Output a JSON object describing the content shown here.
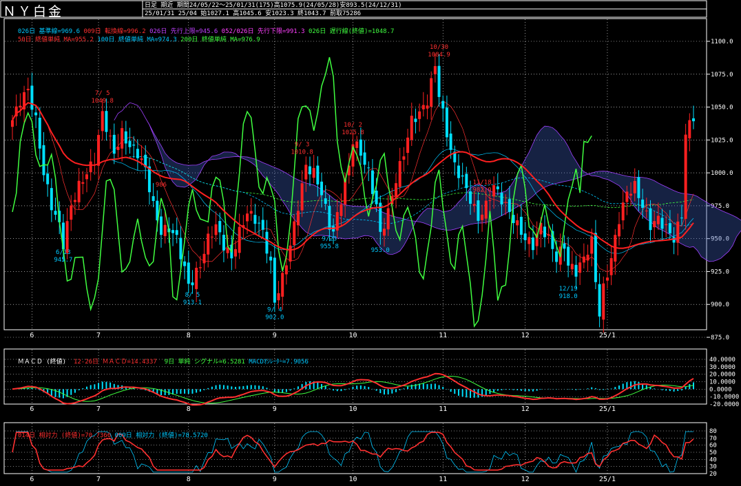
{
  "title": "ＮＹ白金",
  "info_row1": "日足 期近 期間24/05/22～25/01/31(175)高1075.9(24/05/28)安893.5(24/12/31)",
  "info_row2": "25/01/31 25/04 始1027.1 高1045.6 安1023.3 終1043.7 前取75286",
  "legend1": [
    {
      "text": "026日 基準線=969.6",
      "color": "#00c8ff"
    },
    {
      "text": "009日 転換線=996.2",
      "color": "#ff3030"
    },
    {
      "text": "026日 先行上限=945.6",
      "color": "#c040ff"
    },
    {
      "text": "052/026日 先行下限=991.3",
      "color": "#ff40ff"
    },
    {
      "text": "026日 遅行線(終値)=1048.7",
      "color": "#40ff40"
    }
  ],
  "legend2": [
    {
      "text": "50日 終値単純 MA=955.2",
      "color": "#ff3030"
    },
    {
      "text": "100日 終値単純 MA=974.3",
      "color": "#00c8ff"
    },
    {
      "text": "200日 終値単純 MA=976.9",
      "color": "#40ff40"
    }
  ],
  "macd_legend": [
    {
      "text": "ＭＡＣＤ (終値)",
      "color": "#ffffff"
    },
    {
      "text": "12-26日 ＭＡＣＤ=14.4337",
      "color": "#ff3030"
    },
    {
      "text": "9日 単純 シグナル=6.5281",
      "color": "#40ff40"
    },
    {
      "text": "MACDｵｼﾚｰﾀｰ=7.9056",
      "color": "#00c8ff"
    }
  ],
  "rsi_legend": [
    {
      "text": "014日 相対力 (終値)=70.7366",
      "color": "#ff3030"
    },
    {
      "text": "009日 相対力 (終値)=78.5720",
      "color": "#00c8ff"
    }
  ],
  "x_labels": [
    {
      "label": "6",
      "day": 5
    },
    {
      "label": "7",
      "day": 22
    },
    {
      "label": "8",
      "day": 45
    },
    {
      "label": "9",
      "day": 67
    },
    {
      "label": "10",
      "day": 87
    },
    {
      "label": "11",
      "day": 110
    },
    {
      "label": "12",
      "day": 131
    },
    {
      "label": "25/1",
      "day": 152
    }
  ],
  "chart_data": {
    "type": "candlestick",
    "price_axis": {
      "min": 875,
      "max": 1100,
      "ticks": [
        "1100.0",
        "1075.0",
        "1050.0",
        "1025.0",
        "1000.0",
        "975.0",
        "950.0",
        "925.0",
        "900.0",
        "875.0"
      ]
    },
    "macd_axis": {
      "min": -20,
      "max": 40,
      "ticks": [
        "40.0000",
        "30.0000",
        "20.0000",
        "10.0000",
        "0.0000",
        "-10.0000",
        "-20.0000"
      ]
    },
    "rsi_axis": {
      "min": 20,
      "max": 80,
      "ticks": [
        "80",
        "70",
        "60",
        "50",
        "40",
        "30",
        "20"
      ]
    },
    "days": 175,
    "close_anchors": [
      [
        0,
        1040
      ],
      [
        2,
        1055
      ],
      [
        4,
        1063
      ],
      [
        6,
        1040
      ],
      [
        8,
        1000
      ],
      [
        10,
        975
      ],
      [
        12,
        960
      ],
      [
        13,
        946
      ],
      [
        15,
        975
      ],
      [
        17,
        990
      ],
      [
        19,
        1000
      ],
      [
        21,
        1010
      ],
      [
        23,
        1045
      ],
      [
        24,
        1035
      ],
      [
        26,
        1015
      ],
      [
        28,
        1030
      ],
      [
        30,
        1020
      ],
      [
        32,
        1015
      ],
      [
        34,
        1003
      ],
      [
        36,
        975
      ],
      [
        38,
        955
      ],
      [
        40,
        958
      ],
      [
        42,
        950
      ],
      [
        45,
        915
      ],
      [
        46,
        918
      ],
      [
        48,
        930
      ],
      [
        50,
        950
      ],
      [
        52,
        960
      ],
      [
        54,
        945
      ],
      [
        56,
        935
      ],
      [
        58,
        955
      ],
      [
        60,
        970
      ],
      [
        62,
        965
      ],
      [
        64,
        955
      ],
      [
        66,
        930
      ],
      [
        67,
        902
      ],
      [
        69,
        920
      ],
      [
        71,
        945
      ],
      [
        73,
        975
      ],
      [
        75,
        1005
      ],
      [
        77,
        1000
      ],
      [
        79,
        985
      ],
      [
        81,
        960
      ],
      [
        82,
        955
      ],
      [
        84,
        980
      ],
      [
        86,
        1005
      ],
      [
        87,
        1025
      ],
      [
        89,
        1015
      ],
      [
        91,
        1000
      ],
      [
        93,
        975
      ],
      [
        94,
        953
      ],
      [
        96,
        970
      ],
      [
        98,
        995
      ],
      [
        100,
        1015
      ],
      [
        102,
        1040
      ],
      [
        104,
        1045
      ],
      [
        106,
        1055
      ],
      [
        108,
        1082
      ],
      [
        109,
        1060
      ],
      [
        111,
        1030
      ],
      [
        113,
        1005
      ],
      [
        115,
        995
      ],
      [
        117,
        980
      ],
      [
        119,
        965
      ],
      [
        121,
        975
      ],
      [
        123,
        990
      ],
      [
        125,
        980
      ],
      [
        127,
        970
      ],
      [
        129,
        960
      ],
      [
        131,
        950
      ],
      [
        133,
        945
      ],
      [
        135,
        960
      ],
      [
        137,
        950
      ],
      [
        139,
        935
      ],
      [
        141,
        945
      ],
      [
        142,
        930
      ],
      [
        144,
        925
      ],
      [
        146,
        935
      ],
      [
        148,
        948
      ],
      [
        149,
        918
      ],
      [
        150,
        893
      ],
      [
        151,
        912
      ],
      [
        153,
        935
      ],
      [
        155,
        965
      ],
      [
        157,
        985
      ],
      [
        159,
        990
      ],
      [
        161,
        975
      ],
      [
        163,
        960
      ],
      [
        165,
        965
      ],
      [
        167,
        958
      ],
      [
        169,
        950
      ],
      [
        171,
        968
      ],
      [
        172,
        1030
      ],
      [
        174,
        1043
      ]
    ],
    "annotations": [
      {
        "day": 23,
        "value": 1049.8,
        "text1": "7/ 5",
        "text2": "1049.8",
        "color": "#ff3030",
        "pos": "above"
      },
      {
        "day": 109,
        "value": 1084.9,
        "text1": "10/30",
        "text2": "1084.9",
        "color": "#ff3030",
        "pos": "above"
      },
      {
        "day": 87,
        "value": 1025.8,
        "text1": "10/ 2",
        "text2": "1025.8",
        "color": "#ff3030",
        "pos": "above"
      },
      {
        "day": 74,
        "value": 1010.8,
        "text1": "9/ 3",
        "text2": "1010.8",
        "color": "#ff3030",
        "pos": "above"
      },
      {
        "day": 120,
        "value": 982.0,
        "text1": "11/18",
        "text2": "982.0",
        "color": "#ff3030",
        "pos": "above"
      },
      {
        "day": 38,
        "value": 986.0,
        "text1": "",
        "text2": "986",
        "color": "#ff3030",
        "pos": "above"
      },
      {
        "day": 13,
        "value": 945.7,
        "text1": "6/13",
        "text2": "945.7",
        "color": "#00c8ff",
        "pos": "below"
      },
      {
        "day": 46,
        "value": 913.1,
        "text1": "8/ 5",
        "text2": "913.1",
        "color": "#00c8ff",
        "pos": "below"
      },
      {
        "day": 67,
        "value": 902.0,
        "text1": "9/ 4",
        "text2": "902.0",
        "color": "#00c8ff",
        "pos": "below"
      },
      {
        "day": 81,
        "value": 955.8,
        "text1": "9/23",
        "text2": "955.8",
        "color": "#00c8ff",
        "pos": "below"
      },
      {
        "day": 94,
        "value": 953.0,
        "text1": "",
        "text2": "953.0",
        "color": "#00c8ff",
        "pos": "below"
      },
      {
        "day": 142,
        "value": 918.0,
        "text1": "12/19",
        "text2": "918.0",
        "color": "#00c8ff",
        "pos": "below"
      }
    ],
    "colors": {
      "up": "#ff2020",
      "down": "#00e0ff",
      "ma50": "#ff2020",
      "ma100": "#00c8ff",
      "ma200": "#40ff40",
      "lagging": "#40ff40",
      "kumo": "#a040ff",
      "grid": "#ffffff",
      "axis_text": "#ffffff"
    }
  }
}
